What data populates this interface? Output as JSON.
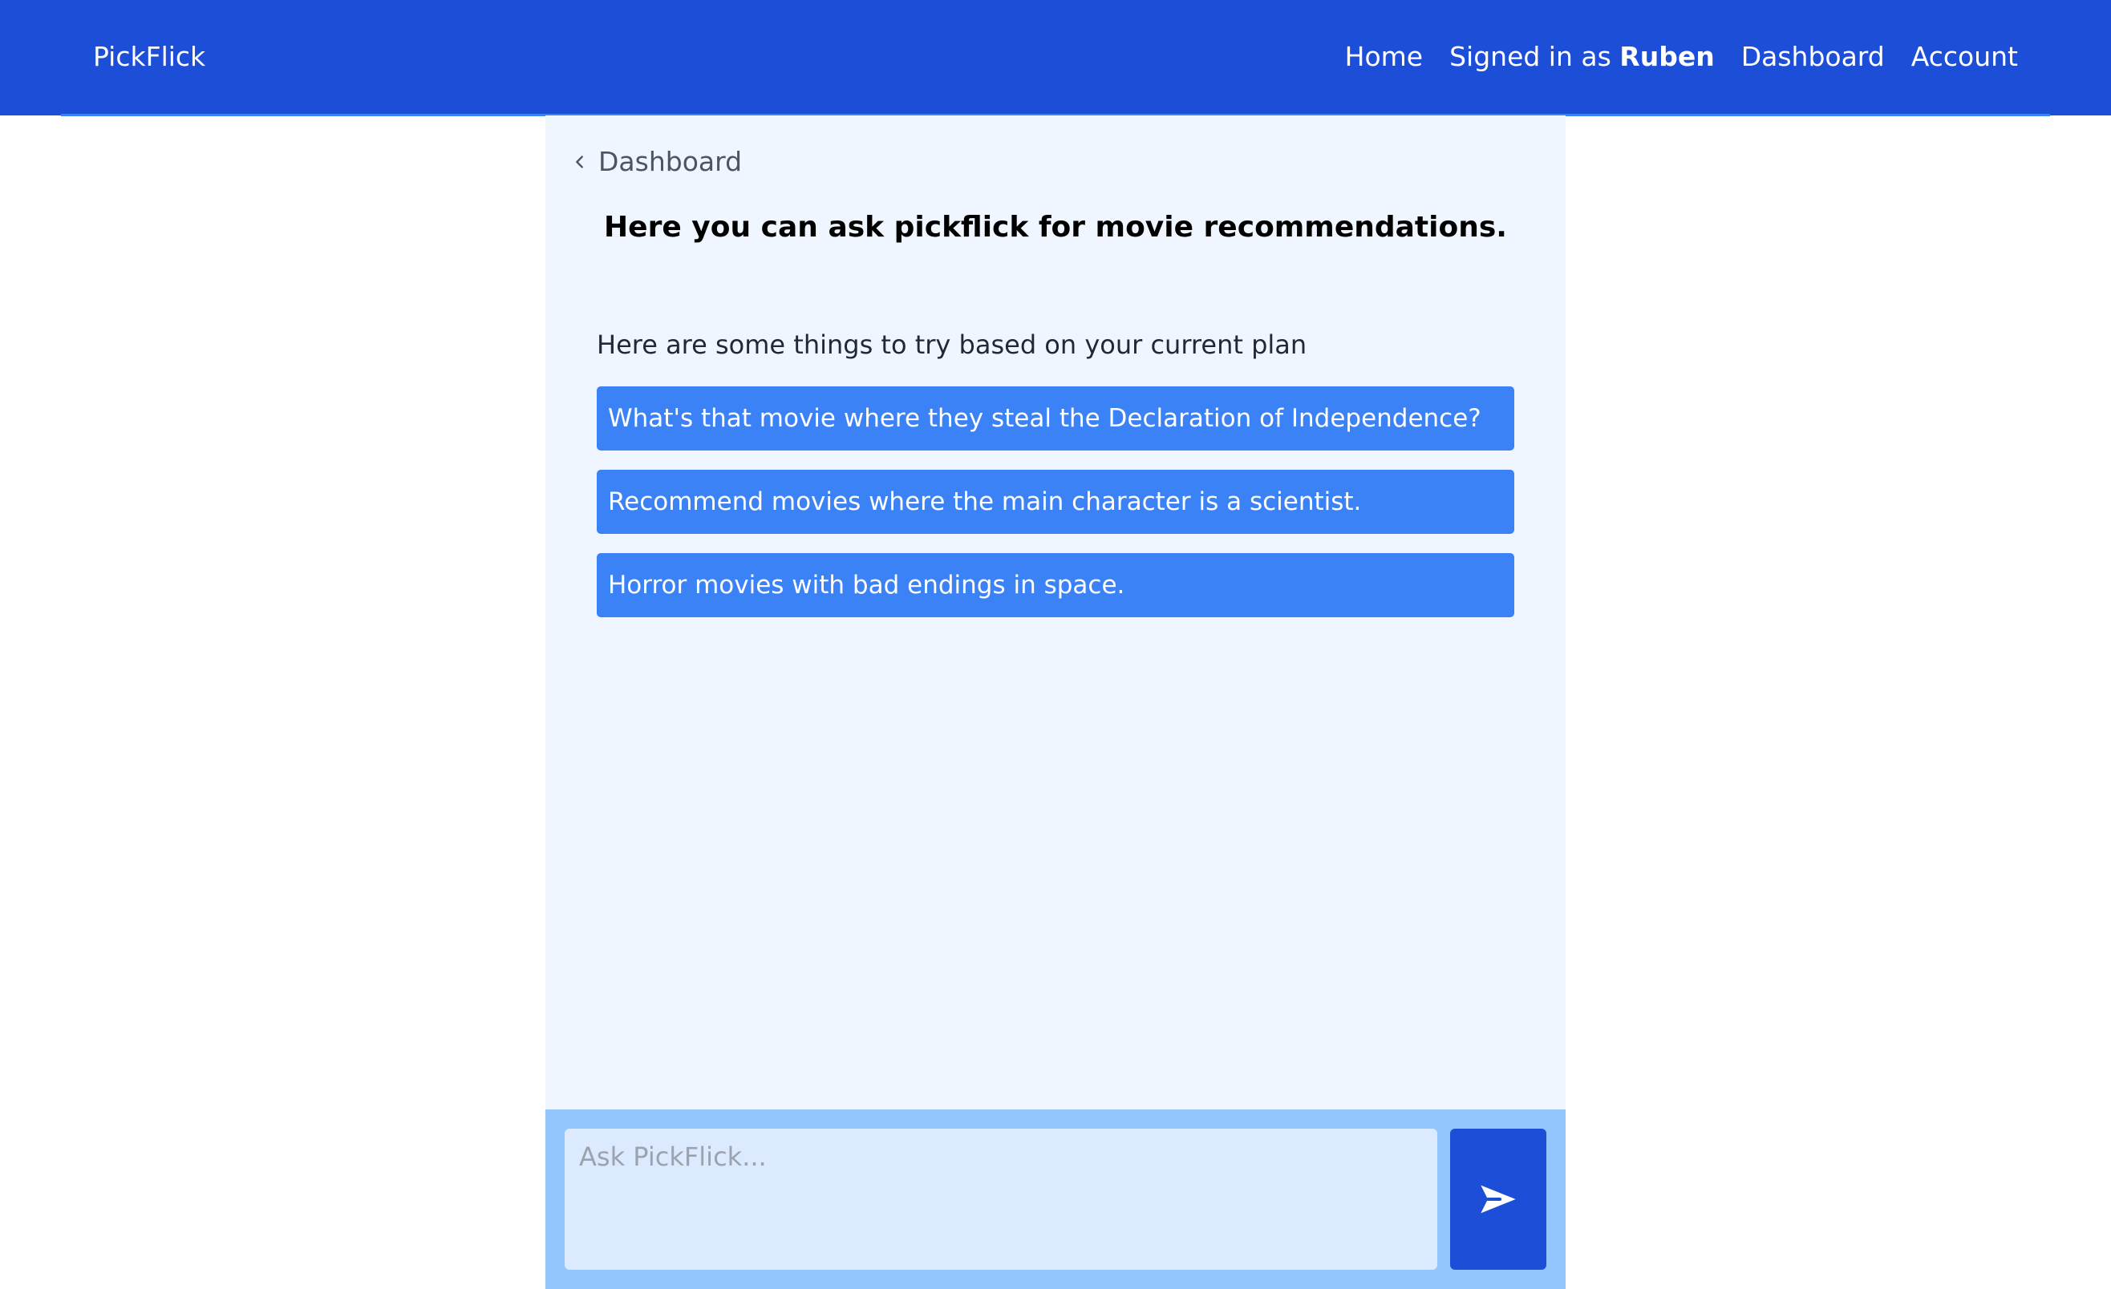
{
  "navbar": {
    "brand": "PickFlick",
    "links": {
      "home": "Home",
      "signed_in_prefix": "Signed in as ",
      "username": "Ruben",
      "dashboard": "Dashboard",
      "account": "Account"
    }
  },
  "main": {
    "back_link": "Dashboard",
    "title": "Here you can ask pickflick for movie recommendations.",
    "suggestions_label": "Here are some things to try based on your current plan",
    "suggestions": [
      "What's that movie where they steal the Declaration of Independence?",
      "Recommend movies where the main character is a scientist.",
      "Horror movies with bad endings in space."
    ]
  },
  "input": {
    "value": "",
    "placeholder": "Ask PickFlick..."
  },
  "icons": {
    "back": "chevron-left-icon",
    "send": "paper-plane-icon"
  },
  "colors": {
    "navbar": "#1d4ed8",
    "panel": "#eff6ff",
    "suggestion": "#3b82f6",
    "input_bar": "#93c5fd",
    "input_field": "#dbeafe",
    "send_button": "#1d4ed8"
  }
}
